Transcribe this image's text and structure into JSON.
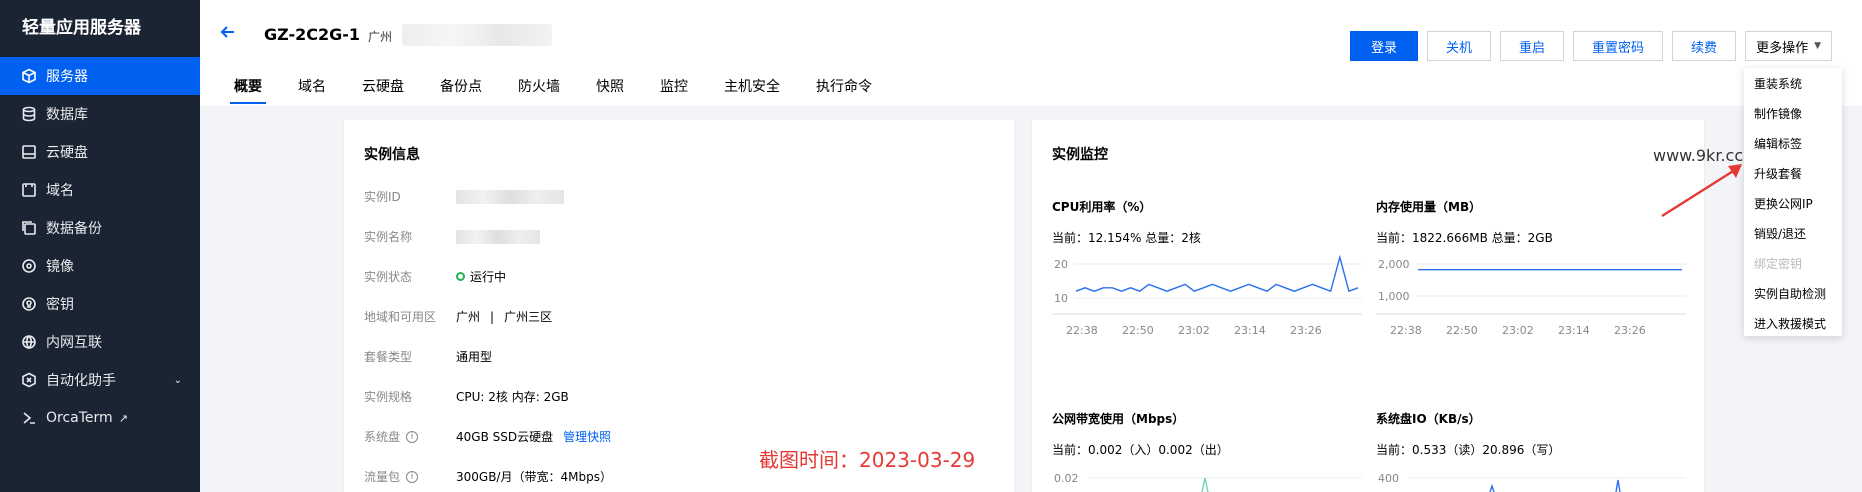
{
  "sidebar": {
    "brand": "轻量应用服务器",
    "items": [
      {
        "label": "服务器",
        "icon": "cube-icon",
        "active": true
      },
      {
        "label": "数据库",
        "icon": "database-icon"
      },
      {
        "label": "云硬盘",
        "icon": "disk-icon"
      },
      {
        "label": "域名",
        "icon": "domain-icon"
      },
      {
        "label": "数据备份",
        "icon": "backup-icon"
      },
      {
        "label": "镜像",
        "icon": "image-icon"
      },
      {
        "label": "密钥",
        "icon": "key-icon"
      },
      {
        "label": "内网互联",
        "icon": "network-icon"
      },
      {
        "label": "自动化助手",
        "icon": "automation-icon"
      },
      {
        "label": "OrcaTerm",
        "icon": "terminal-icon"
      }
    ]
  },
  "header": {
    "instance_name": "GZ-2C2G-1",
    "region": "广州",
    "actions": {
      "login": "登录",
      "shutdown": "关机",
      "restart": "重启",
      "reset_password": "重置密码",
      "renew": "续费",
      "more": "更多操作"
    },
    "tabs": [
      "概要",
      "域名",
      "云硬盘",
      "备份点",
      "防火墙",
      "快照",
      "监控",
      "主机安全",
      "执行命令"
    ]
  },
  "instance_info": {
    "title": "实例信息",
    "rows": {
      "id_label": "实例ID",
      "name_label": "实例名称",
      "status_label": "实例状态",
      "status_value": "运行中",
      "zone_label": "地域和可用区",
      "zone_city": "广州",
      "zone_sep": "|",
      "zone_value": "广州三区",
      "plan_label": "套餐类型",
      "plan_value": "通用型",
      "spec_label": "实例规格",
      "spec_value": "CPU: 2核 内存: 2GB",
      "disk_label": "系统盘",
      "disk_value": "40GB SSD云硬盘",
      "disk_link": "管理快照",
      "traffic_label": "流量包",
      "traffic_value": "300GB/月（带宽：4Mbps）"
    }
  },
  "monitor": {
    "title": "实例监控",
    "cpu": {
      "title": "CPU利用率（%）",
      "current": "当前：12.154% 总量：2核",
      "yticks": [
        "20",
        "10"
      ]
    },
    "mem": {
      "title": "内存使用量（MB）",
      "current": "当前：1822.666MB 总量：2GB",
      "yticks": [
        "2,000",
        "1,000"
      ]
    },
    "net": {
      "title": "公网带宽使用（Mbps）",
      "current": "当前：0.002（入）0.002（出）",
      "ytick": "0.02"
    },
    "io": {
      "title": "系统盘IO（KB/s）",
      "current": "当前：0.533（读）20.896（写）",
      "ytick": "400"
    },
    "xticks": [
      "22:38",
      "22:50",
      "23:02",
      "23:14",
      "23:26"
    ],
    "line_color": "#2a6ff0"
  },
  "chart_data": [
    {
      "type": "line",
      "title": "CPU利用率（%）",
      "x": [
        "22:38",
        "22:50",
        "23:02",
        "23:14",
        "23:26"
      ],
      "series": [
        {
          "values": [
            12,
            13,
            12,
            13,
            13,
            12,
            13,
            12,
            14,
            13,
            12,
            13,
            14,
            12,
            13,
            14,
            13,
            12,
            13,
            14,
            13,
            12,
            14,
            13,
            12,
            13,
            14,
            13,
            12,
            22,
            12,
            13
          ]
        }
      ],
      "yticks": [
        10,
        20
      ]
    },
    {
      "type": "line",
      "title": "内存使用量（MB）",
      "x": [
        "22:38",
        "22:50",
        "23:02",
        "23:14",
        "23:26"
      ],
      "series": [
        {
          "values": [
            1822,
            1822,
            1823,
            1822,
            1822,
            1823,
            1822,
            1822
          ]
        }
      ],
      "yticks": [
        1000,
        2000
      ]
    }
  ],
  "dropdown": {
    "items": [
      {
        "label": "重装系统",
        "disabled": false
      },
      {
        "label": "制作镜像",
        "disabled": false
      },
      {
        "label": "编辑标签",
        "disabled": false
      },
      {
        "label": "升级套餐",
        "disabled": false
      },
      {
        "label": "更换公网IP",
        "disabled": false
      },
      {
        "label": "销毁/退还",
        "disabled": false
      },
      {
        "label": "绑定密钥",
        "disabled": true
      },
      {
        "label": "实例自助检测",
        "disabled": false
      },
      {
        "label": "进入救援模式",
        "disabled": false
      }
    ]
  },
  "overlay": {
    "watermark": "www.9kr.cc",
    "stamp": "截图时间：2023-03-29",
    "stamp_color": "#e53935"
  }
}
